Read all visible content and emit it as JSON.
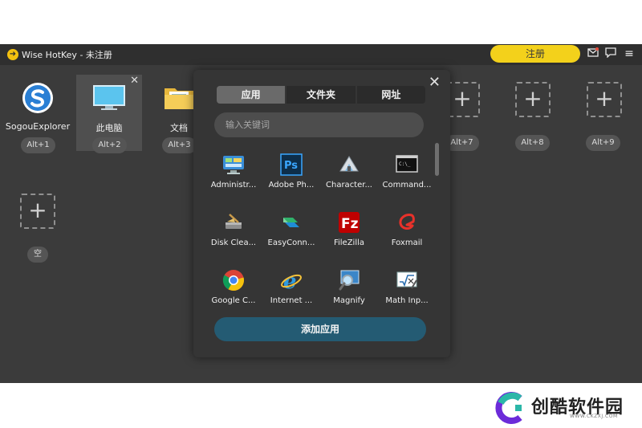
{
  "window": {
    "title": "Wise HotKey - 未注册",
    "register_label": "注册"
  },
  "slots": [
    {
      "label": "SogouExplorer",
      "key": "Alt+1"
    },
    {
      "label": "此电脑",
      "key": "Alt+2"
    },
    {
      "label": "文档",
      "key": "Alt+3"
    }
  ],
  "empty_slots": [
    {
      "key": "Alt+7"
    },
    {
      "key": "Alt+8"
    },
    {
      "key": "Alt+9"
    },
    {
      "key": "空"
    }
  ],
  "popup": {
    "tabs": [
      "应用",
      "文件夹",
      "网址"
    ],
    "selected_tab": "应用",
    "search_placeholder": "输入关键词",
    "apps": [
      {
        "label": "Administr...",
        "icon": "control-panel-icon"
      },
      {
        "label": "Adobe Ph...",
        "icon": "photoshop-icon"
      },
      {
        "label": "Character...",
        "icon": "character-map-icon"
      },
      {
        "label": "Command...",
        "icon": "command-prompt-icon"
      },
      {
        "label": "Disk Clea...",
        "icon": "disk-cleanup-icon"
      },
      {
        "label": "EasyConn...",
        "icon": "easyconnect-icon"
      },
      {
        "label": "FileZilla",
        "icon": "filezilla-icon"
      },
      {
        "label": "Foxmail",
        "icon": "foxmail-icon"
      },
      {
        "label": "Google C...",
        "icon": "chrome-icon"
      },
      {
        "label": "Internet ...",
        "icon": "internet-explorer-icon"
      },
      {
        "label": "Magnify",
        "icon": "magnifier-icon"
      },
      {
        "label": "Math Inp...",
        "icon": "math-input-icon"
      }
    ],
    "add_label": "添加应用"
  },
  "watermark": {
    "text": "创酷软件园",
    "url": "WWW.CKZXJ.COM"
  },
  "colors": {
    "accent": "#f3d11b",
    "add_button": "#245b73",
    "background": "#3b3b3b"
  }
}
